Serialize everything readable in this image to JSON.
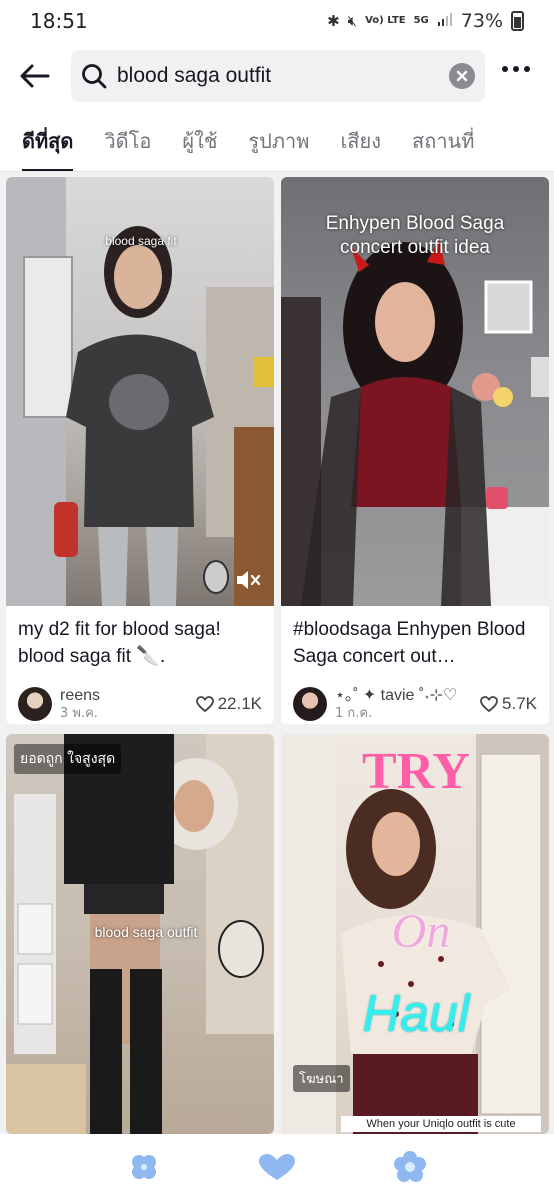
{
  "status_bar": {
    "time": "18:51",
    "network": "Vo) LTE",
    "network_5g": "5G",
    "battery": "73%"
  },
  "search": {
    "query": "blood saga outfit"
  },
  "tabs": [
    {
      "label": "ดีที่สุด",
      "active": true
    },
    {
      "label": "วิดีโอ",
      "active": false
    },
    {
      "label": "ผู้ใช้",
      "active": false
    },
    {
      "label": "รูปภาพ",
      "active": false
    },
    {
      "label": "เสียง",
      "active": false
    },
    {
      "label": "สถานที่",
      "active": false
    }
  ],
  "results": [
    {
      "overlay": "blood saga fit",
      "caption": "my d2 fit for blood saga! blood saga fit 🔪.",
      "author": "reens",
      "date": "3 พ.ค.",
      "likes": "22.1K"
    },
    {
      "overlay": "Enhypen Blood Saga concert outfit idea",
      "caption": "#bloodsaga Enhypen Blood Saga concert out…",
      "author": "⋆｡˚ ✦ tavie ˚˖⊹♡",
      "date": "1 ก.ค.",
      "likes": "5.7K"
    },
    {
      "badge": "ยอดถูก ใจสูงสุด",
      "overlay": "blood saga outfit"
    },
    {
      "overlay_try": "TRY",
      "overlay_on": "On",
      "overlay_haul": "Haul",
      "ad_badge": "โฆษณา",
      "bottom_text": "When your Uniqlo outfit is cute"
    }
  ],
  "colors": {
    "accent": "#161823",
    "nav_icon": "#8fb8f0",
    "pink": "#ff5fa8",
    "cyan": "#2ff0f0"
  }
}
